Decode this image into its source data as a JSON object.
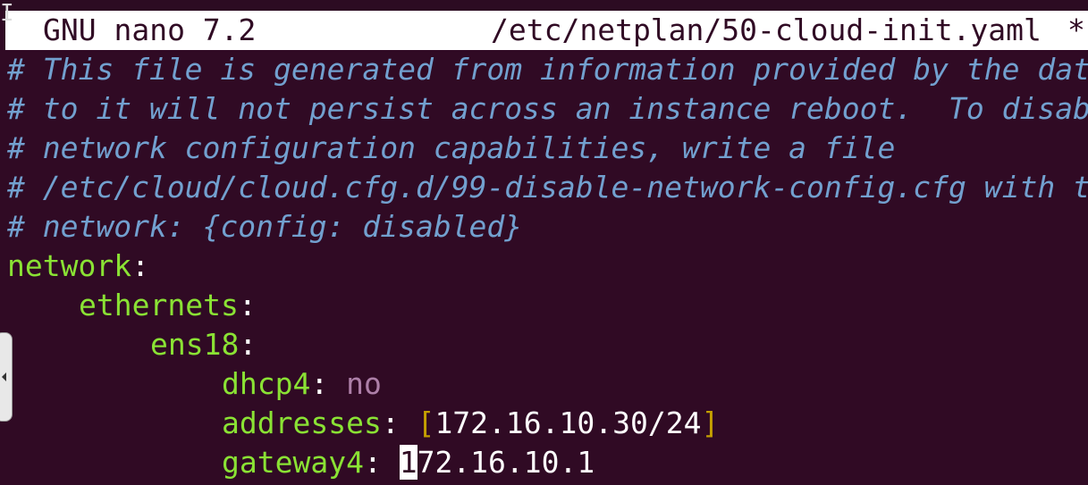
{
  "titlebar": {
    "app": "GNU nano 7.2",
    "file": "/etc/netplan/50-cloud-init.yaml",
    "modified": "*"
  },
  "lines": {
    "c1": "# This file is generated from information provided by the dat",
    "c2": "# to it will not persist across an instance reboot.  To disab",
    "c3": "# network configuration capabilities, write a file",
    "c4": "# /etc/cloud/cloud.cfg.d/99-disable-network-config.cfg with t",
    "c5": "# network: {config: disabled}",
    "network_key": "network",
    "ethernets_key": "ethernets",
    "iface_key": "ens18",
    "dhcp4_key": "dhcp4",
    "dhcp4_value": "no",
    "addresses_key": "addresses",
    "addresses_value": "172.16.10.30/24",
    "gateway4_key": "gateway4",
    "gateway4_cursor_char": "1",
    "gateway4_rest": "72.16.10.1",
    "colon": ":",
    "open_bracket": "[",
    "close_bracket": "]"
  },
  "colors": {
    "background": "#300a24",
    "comment": "#72a0cf",
    "key": "#8ae234",
    "bool": "#ad7fa8",
    "bracket": "#c4a000"
  },
  "icons": {
    "side_handle": "collapse-handle-icon",
    "text_cursor": "i-beam-cursor-icon"
  }
}
